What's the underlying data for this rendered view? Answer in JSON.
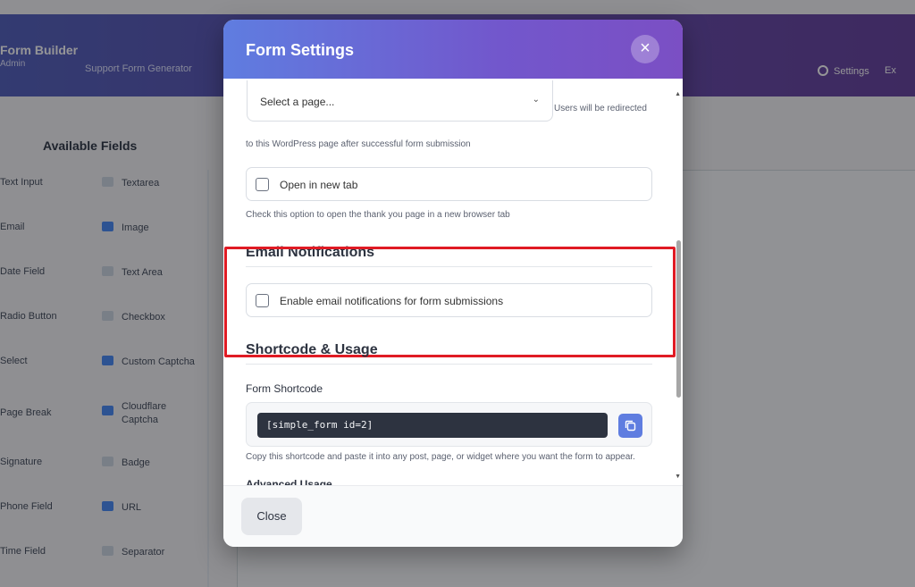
{
  "background": {
    "brand": "Form Builder",
    "brand_sub": "Admin",
    "header_link": "Support Form Generator",
    "settings_label": "Settings",
    "extra_label": "Ex",
    "sidebar_title": "Available Fields",
    "fields_left": [
      "Text Input",
      "Email",
      "Date Field",
      "Radio Button",
      "Select",
      "Page Break",
      "Signature",
      "Phone Field",
      "Time Field"
    ],
    "fields_right": [
      "Textarea",
      "Image",
      "Text Area",
      "Checkbox",
      "Custom Captcha",
      "Cloudflare Captcha",
      "Badge",
      "URL",
      "Separator"
    ]
  },
  "modal": {
    "title": "Form Settings",
    "close_icon": "×",
    "redirect_select": {
      "placeholder": "Select a page..."
    },
    "redirect_help_inline": "Users will be redirected",
    "redirect_help_wrap": "to this WordPress page after successful form submission",
    "open_new_tab": {
      "label": "Open in new tab",
      "checked": false
    },
    "open_new_tab_help": "Check this option to open the thank you page in a new browser tab",
    "email_section": {
      "title": "Email Notifications",
      "enable_label": "Enable email notifications for form submissions",
      "checked": false
    },
    "shortcode_section": {
      "title": "Shortcode & Usage",
      "label": "Form Shortcode",
      "code": "[simple_form id=2]",
      "help": "Copy this shortcode and paste it into any post, page, or widget where you want the form to appear.",
      "advanced_label": "Advanced Usage"
    },
    "footer": {
      "close_label": "Close"
    }
  },
  "colors": {
    "header_gradient_start": "#5f7de0",
    "header_gradient_end": "#7b4fc4",
    "highlight": "#e01b24",
    "code_bg": "#2d3340",
    "copy_button": "#5f7de0"
  }
}
